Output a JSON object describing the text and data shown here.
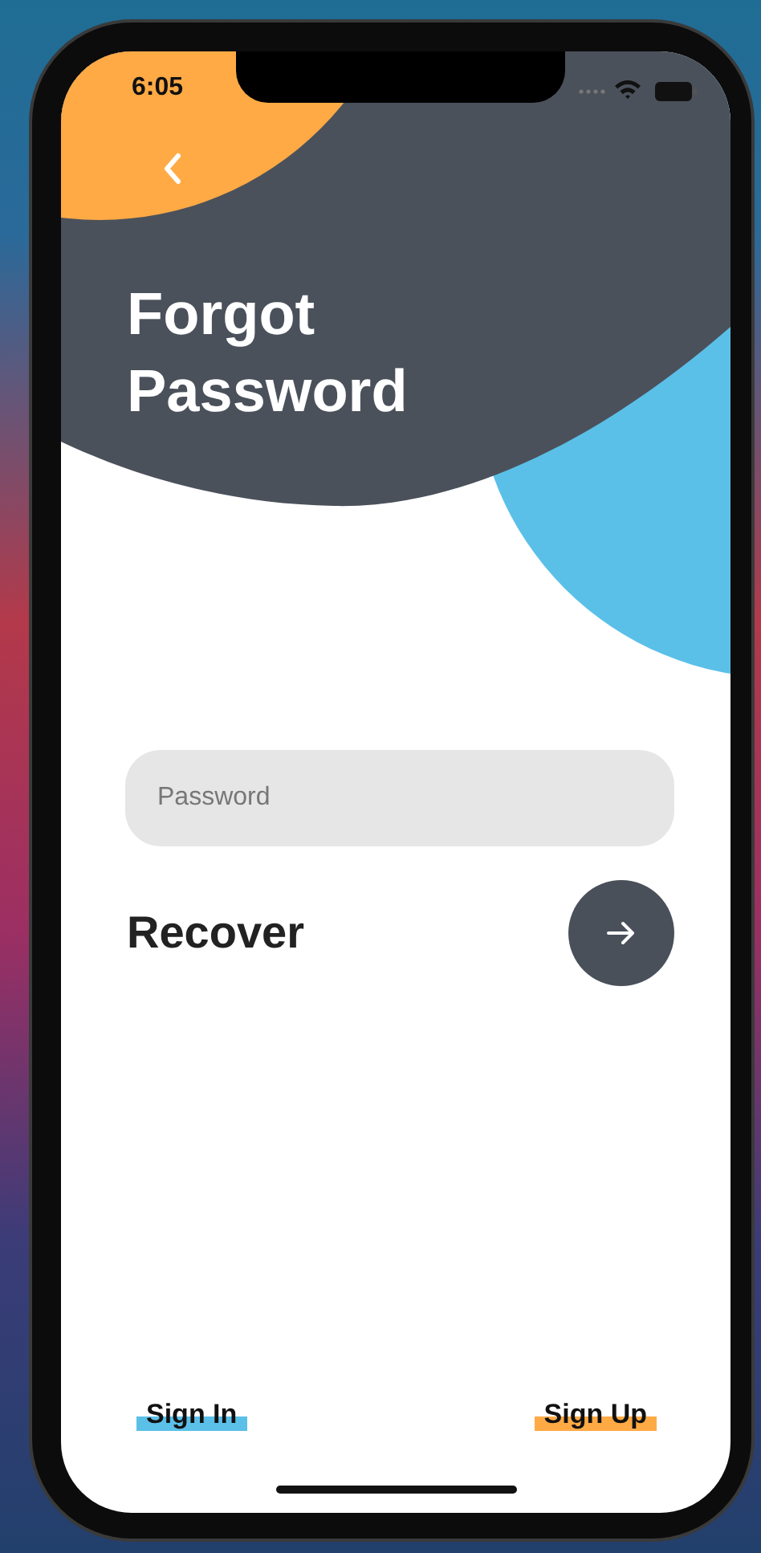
{
  "status_bar": {
    "time": "6:05"
  },
  "header": {
    "title": "Forgot Password"
  },
  "password_field": {
    "placeholder": "Password"
  },
  "recover": {
    "label": "Recover"
  },
  "footer_links": [
    {
      "label": "Sign In",
      "color": "#5bc0e8"
    },
    {
      "label": "Sign Up",
      "color": "#ffaa45"
    }
  ]
}
